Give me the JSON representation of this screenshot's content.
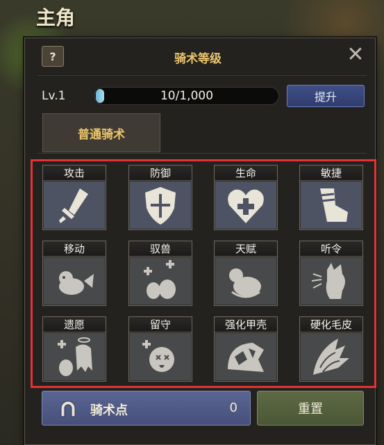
{
  "header": {
    "title": "主角"
  },
  "panel": {
    "title": "骑术等级",
    "help_label": "?",
    "close_label": "✕"
  },
  "level": {
    "label": "Lv.1",
    "progress_text": "10/1,000",
    "progress_fraction": 0.01,
    "upgrade_label": "提升"
  },
  "tabs": [
    {
      "label": "普通骑术"
    }
  ],
  "skills": [
    {
      "label": "攻击",
      "icon": "sword-icon",
      "state": "active"
    },
    {
      "label": "防御",
      "icon": "shield-icon",
      "state": "active"
    },
    {
      "label": "生命",
      "icon": "heart-plus-icon",
      "state": "active"
    },
    {
      "label": "敏捷",
      "icon": "boot-icon",
      "state": "active"
    },
    {
      "label": "移动",
      "icon": "mount-run-icon",
      "state": "locked"
    },
    {
      "label": "驭兽",
      "icon": "pets-plus-icon",
      "state": "locked"
    },
    {
      "label": "天赋",
      "icon": "pet-dog-icon",
      "state": "locked"
    },
    {
      "label": "听令",
      "icon": "pet-cat-icon",
      "state": "locked"
    },
    {
      "label": "遗愿",
      "icon": "ghost-icon",
      "state": "locked"
    },
    {
      "label": "留守",
      "icon": "defeated-pet-icon",
      "state": "locked"
    },
    {
      "label": "强化甲壳",
      "icon": "shell-icon",
      "state": "locked"
    },
    {
      "label": "硬化毛皮",
      "icon": "fur-icon",
      "state": "locked"
    }
  ],
  "footer": {
    "points_label": "骑术点",
    "points_value": "0",
    "points_icon": "horseshoe-icon",
    "reset_label": "重置"
  },
  "colors": {
    "highlight_border": "#e53236",
    "title_gold": "#e9c46c",
    "upgrade_blue": "#3f4f86",
    "reset_green": "#5e6a45"
  }
}
